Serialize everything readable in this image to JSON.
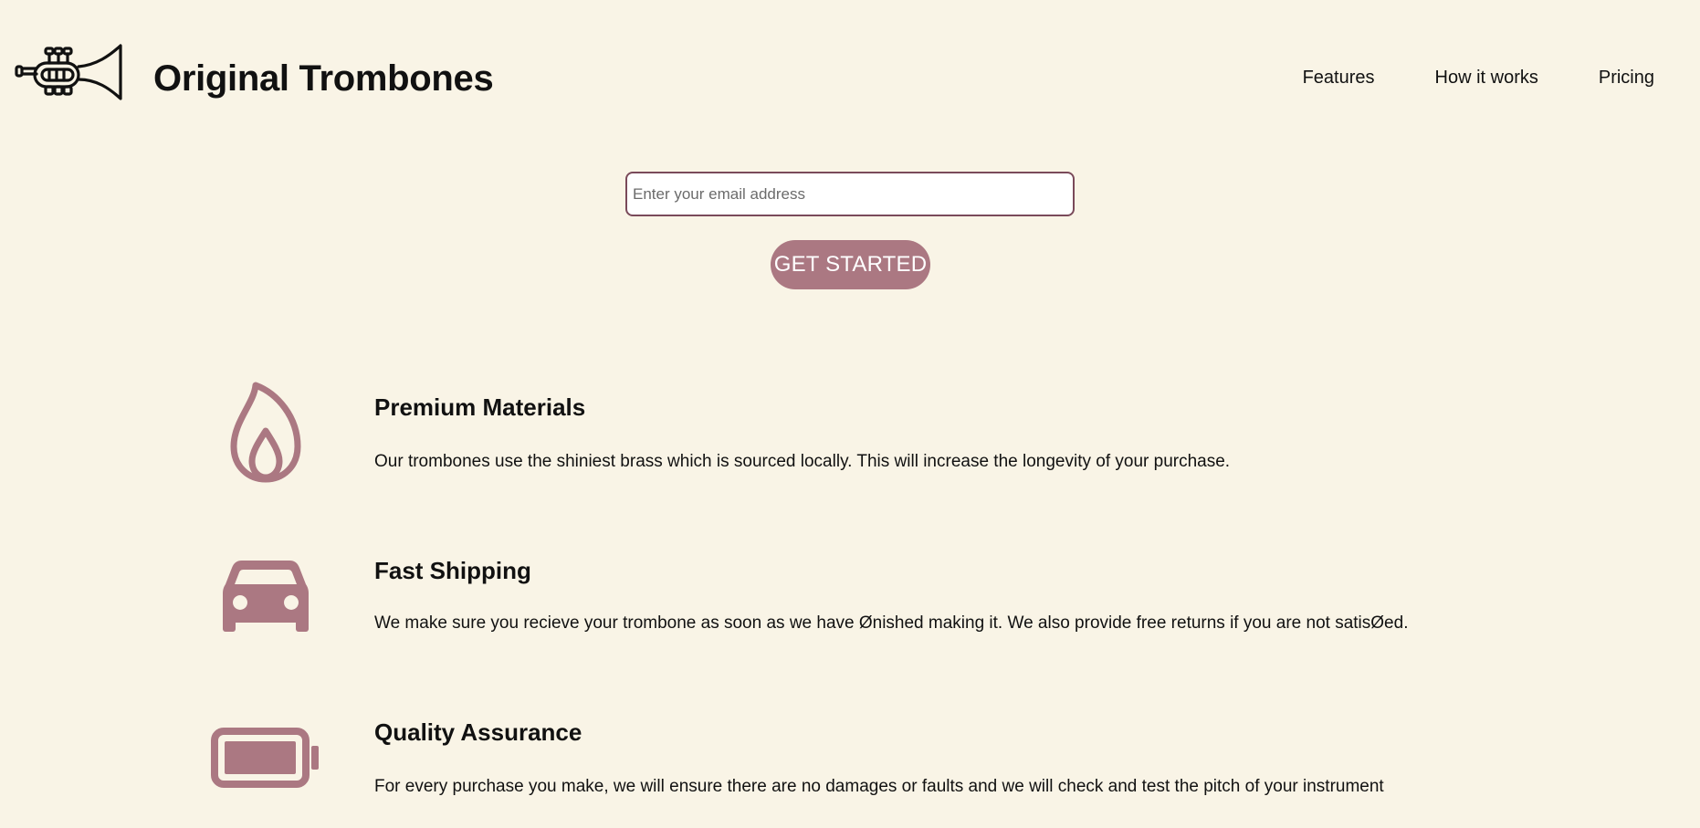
{
  "header": {
    "title": "Original Trombones",
    "logo_icon": "trumpet-icon",
    "nav": [
      {
        "label": "Features"
      },
      {
        "label": "How it works"
      },
      {
        "label": "Pricing"
      }
    ]
  },
  "form": {
    "email_placeholder": "Enter your email address",
    "email_value": "",
    "submit_label": "GET STARTED"
  },
  "features": [
    {
      "icon": "fire-icon",
      "title": "Premium Materials",
      "description": "Our trombones use the shiniest brass which is sourced locally. This will increase the longevity of your purchase."
    },
    {
      "icon": "car-icon",
      "title": "Fast Shipping",
      "description": "We make sure you recieve your trombone as soon as we have Ønished making it. We also provide free returns if you are not satisØed."
    },
    {
      "icon": "battery-icon",
      "title": "Quality Assurance",
      "description": "For every purchase you make, we will ensure there are no damages or faults and we will check and test the pitch of your instrument"
    }
  ],
  "colors": {
    "background": "#f9f4e6",
    "accent": "#ab7882",
    "input_border": "#7a4a5a",
    "text": "#111111"
  }
}
